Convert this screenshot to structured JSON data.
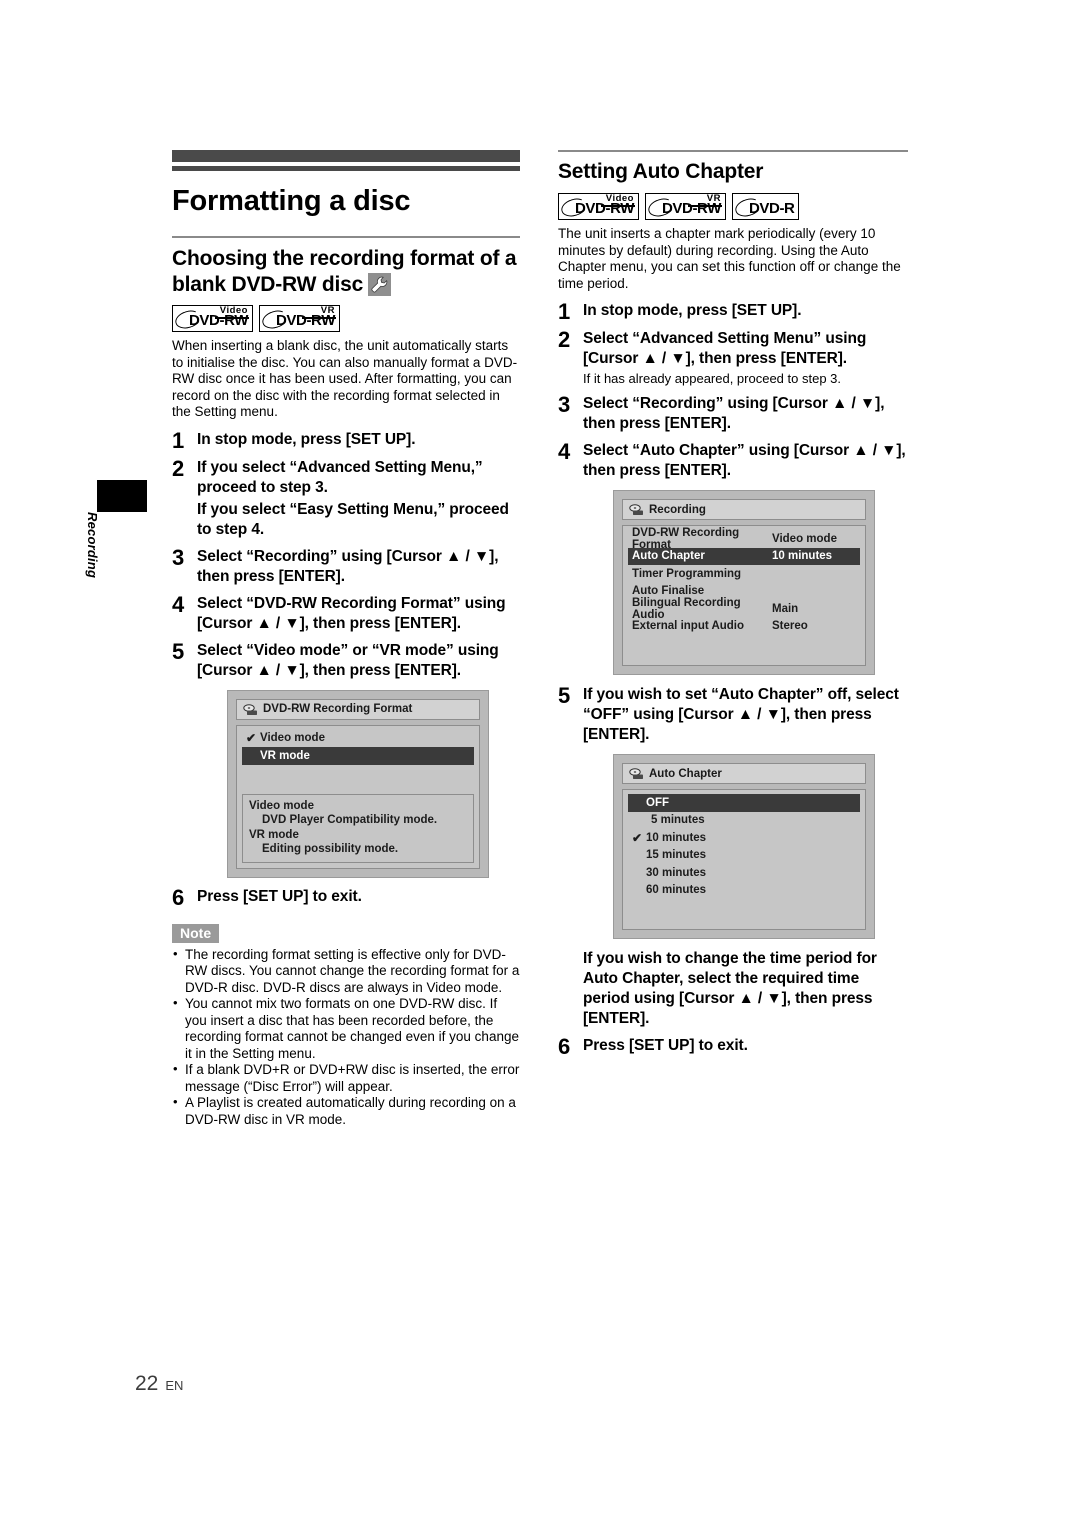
{
  "side_tab": {
    "label": "Recording"
  },
  "footer": {
    "page_number": "22",
    "language": "EN"
  },
  "left": {
    "page_title": "Formatting a disc",
    "section_title": "Choosing the recording format of a blank DVD-RW disc",
    "wrench_icon": "wrench-icon",
    "logos": [
      {
        "sup": "Video",
        "main": "DVD-RW"
      },
      {
        "sup": "VR",
        "main": "DVD-RW"
      }
    ],
    "intro": "When inserting a blank disc, the unit automatically starts to initialise the disc. You can also manually format a DVD-RW disc once it has been used. After formatting, you can record on the disc with the recording format selected in the Setting menu.",
    "steps": [
      {
        "num": "1",
        "text": "In stop mode, press [SET UP].",
        "sub": ""
      },
      {
        "num": "2",
        "text": "If you select “Advanced Setting Menu,” proceed to step 3.",
        "sub": "If you select “Easy Setting Menu,” proceed to step 4."
      },
      {
        "num": "3",
        "text": "Select “Recording” using [Cursor ▲ / ▼], then press [ENTER].",
        "sub": ""
      },
      {
        "num": "4",
        "text": "Select “DVD-RW Recording Format” using [Cursor ▲ / ▼], then press [ENTER].",
        "sub": ""
      },
      {
        "num": "5",
        "text": "Select “Video mode” or “VR mode” using [Cursor ▲ / ▼], then press [ENTER].",
        "sub": ""
      }
    ],
    "osd": {
      "title": "DVD-RW Recording Format",
      "title_icon": "disc-recorder-icon",
      "rows": [
        {
          "check": "✔",
          "label": "Video mode",
          "selected": false
        },
        {
          "check": "",
          "label": "VR mode",
          "selected": true
        }
      ],
      "desc": [
        {
          "text": "Video mode",
          "indent": false
        },
        {
          "text": "DVD Player Compatibility mode.",
          "indent": true
        },
        {
          "text": "VR mode",
          "indent": false
        },
        {
          "text": "Editing possibility mode.",
          "indent": true
        }
      ]
    },
    "final_step": {
      "num": "6",
      "text": "Press [SET UP] to exit."
    },
    "note_badge": "Note",
    "notes": [
      "The recording format setting is effective only for DVD-RW discs. You cannot change the recording format for a DVD-R disc. DVD-R discs are always in Video mode.",
      "You cannot mix two formats on one DVD-RW disc. If you insert a disc that has been recorded before, the recording format cannot be changed even if you change it in the Setting menu.",
      "If a blank DVD+R or DVD+RW disc is inserted, the error message (“Disc Error”) will appear.",
      "A Playlist is created automatically during recording on a DVD-RW disc in VR mode."
    ]
  },
  "right": {
    "section_title": "Setting Auto Chapter",
    "logos": [
      {
        "sup": "Video",
        "main": "DVD-RW"
      },
      {
        "sup": "VR",
        "main": "DVD-RW"
      },
      {
        "sup": "",
        "main": "DVD-R"
      }
    ],
    "intro": "The unit inserts a chapter mark periodically (every 10 minutes by default) during recording. Using the Auto Chapter menu, you can set this function off or change the time period.",
    "steps": [
      {
        "num": "1",
        "text": "In stop mode, press [SET UP].",
        "sub": ""
      },
      {
        "num": "2",
        "text": "Select “Advanced Setting Menu” using [Cursor ▲ / ▼], then press [ENTER].",
        "sub": "If it has already appeared, proceed to step 3."
      },
      {
        "num": "3",
        "text": "Select “Recording” using [Cursor ▲ / ▼], then press [ENTER].",
        "sub": ""
      },
      {
        "num": "4",
        "text": "Select “Auto Chapter” using [Cursor ▲ / ▼], then press [ENTER].",
        "sub": ""
      }
    ],
    "osd_recording": {
      "title": "Recording",
      "title_icon": "disc-recorder-icon",
      "rows": [
        {
          "label": "DVD-RW Recording Format",
          "value": "Video mode",
          "selected": false
        },
        {
          "label": "Auto Chapter",
          "value": "10 minutes",
          "selected": true
        },
        {
          "label": "Timer Programming",
          "value": "",
          "selected": false
        },
        {
          "label": "Auto Finalise",
          "value": "",
          "selected": false
        },
        {
          "label": "Bilingual Recording Audio",
          "value": "Main",
          "selected": false
        },
        {
          "label": "External input Audio",
          "value": "Stereo",
          "selected": false
        }
      ]
    },
    "step5": {
      "num": "5",
      "text": "If you wish to set “Auto Chapter” off, select “OFF” using [Cursor ▲ / ▼], then press [ENTER]."
    },
    "osd_auto_chapter": {
      "title": "Auto Chapter",
      "title_icon": "disc-recorder-icon",
      "rows": [
        {
          "check": "",
          "label": "OFF",
          "selected": true
        },
        {
          "check": "",
          "label": "5 minutes",
          "selected": false
        },
        {
          "check": "✔",
          "label": "10 minutes",
          "selected": false
        },
        {
          "check": "",
          "label": "15 minutes",
          "selected": false
        },
        {
          "check": "",
          "label": "30 minutes",
          "selected": false
        },
        {
          "check": "",
          "label": "60 minutes",
          "selected": false
        }
      ]
    },
    "closing_paragraph": "If you wish to change the time period for Auto Chapter, select the required time period using [Cursor ▲ / ▼], then press [ENTER].",
    "final_step": {
      "num": "6",
      "text": "Press [SET UP] to exit."
    }
  }
}
